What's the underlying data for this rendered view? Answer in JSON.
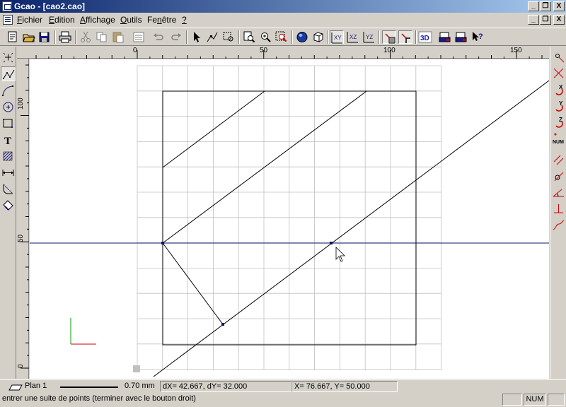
{
  "window": {
    "title": "Gcao - [cao2.cao]",
    "minimize_glyph": "_",
    "maximize_glyph": "□",
    "close_glyph": "X",
    "restore_glyph": "❐"
  },
  "menu": {
    "items": [
      {
        "accel": "F",
        "rest": "ichier"
      },
      {
        "accel": "E",
        "rest": "dition"
      },
      {
        "accel": "A",
        "rest": "ffichage"
      },
      {
        "accel": "O",
        "rest": "utils"
      },
      {
        "pre": "Fe",
        "accel": "n",
        "rest": "être"
      },
      {
        "accel": "?",
        "rest": ""
      }
    ]
  },
  "toolbar": {
    "buttons": [
      "new-icon",
      "open-icon",
      "save-icon",
      "print-icon",
      "cut-icon",
      "copy-icon",
      "paste-icon",
      "properties-icon",
      "undo-icon",
      "redo-icon",
      "select-arrow-icon",
      "edit-node-icon",
      "zoom-window-icon",
      "zoom-all-icon",
      "zoom-in-icon",
      "zoom-area-icon",
      "sphere-icon",
      "cube-icon",
      "plane-xy-icon",
      "plane-xz-icon",
      "plane-yz-icon",
      "grid-snap-icon",
      "point-snap-icon",
      "view-3d-icon",
      "print-preview-icon",
      "print-3d-icon",
      "help-pointer-icon"
    ],
    "plane_xy": "XY",
    "plane_xz": "XZ",
    "plane_yz": "YZ",
    "view_3d": "3D"
  },
  "left_tools": [
    "point-icon",
    "polyline-icon",
    "arc-icon",
    "circle-icon",
    "rectangle-icon",
    "text-icon",
    "hatch-icon",
    "dimension-icon",
    "fillet-icon",
    "fill-icon"
  ],
  "left_tools_text": {
    "text_glyph": "T"
  },
  "right_tools": [
    "snap-point-icon",
    "snap-intersection-icon",
    "rotate-x-icon",
    "rotate-y-icon",
    "rotate-z-icon",
    "numeric-entry-icon",
    "parallel-icon",
    "tangent-icon",
    "angle-icon",
    "perpendicular-icon",
    "curve-icon"
  ],
  "right_tools_text": {
    "x": "X",
    "y": "Y",
    "z": "Z",
    "num": "NUM"
  },
  "rulers": {
    "horizontal_labels": [
      "0",
      "50",
      "100",
      "150"
    ],
    "vertical_labels": [
      "100",
      "50",
      "0"
    ]
  },
  "status": {
    "plane": "Plan 1",
    "line_width": "0.70 mm",
    "delta": "dX=    42.667, dY=     32.000",
    "coords": "X=    76.667, Y=     50.000",
    "hint": "entrer une suite de points (terminer avec le bouton droit)",
    "num_indicator": "NUM"
  },
  "colors": {
    "title_start": "#0a246a",
    "title_end": "#a6caf0",
    "grid": "#c0c0c0",
    "geometry": "#000000",
    "construction_line": "#0a1a6a",
    "axis_x": "#cc0000",
    "axis_y": "#009900"
  }
}
